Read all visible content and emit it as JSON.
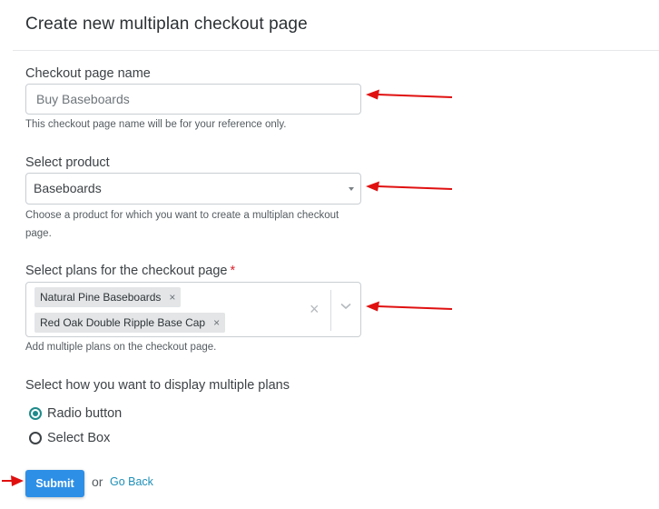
{
  "page": {
    "title": "Create new multiplan checkout page"
  },
  "checkout_name": {
    "label": "Checkout page name",
    "value": "Buy Baseboards",
    "help": "This checkout page name will be for your reference only."
  },
  "product": {
    "label": "Select product",
    "value": "Baseboards",
    "help": "Choose a product for which you want to create a multiplan checkout page."
  },
  "plans": {
    "label": "Select plans for the checkout page",
    "required_mark": "*",
    "selected": [
      "Natural Pine Baseboards",
      "Red Oak Double Ripple Base Cap"
    ],
    "remove_glyph": "×",
    "clear_glyph": "×",
    "help": "Add multiple plans on the checkout page."
  },
  "display": {
    "label": "Select how you want to display multiple plans",
    "options": [
      {
        "label": "Radio button",
        "selected": true
      },
      {
        "label": "Select Box",
        "selected": false
      }
    ]
  },
  "actions": {
    "submit": "Submit",
    "or": "or",
    "go_back": "Go Back"
  },
  "colors": {
    "accent": "#2d8fe6",
    "radio": "#1e8a8a",
    "arrow": "#e01010",
    "link": "#1f8fb8"
  }
}
